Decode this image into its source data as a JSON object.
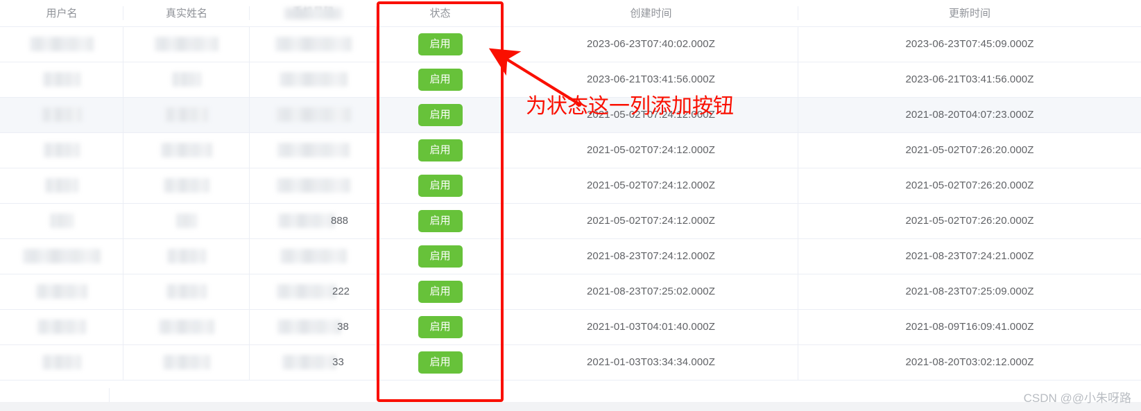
{
  "table": {
    "columns": [
      {
        "key": "username",
        "label": "用户名"
      },
      {
        "key": "realname",
        "label": "真实姓名"
      },
      {
        "key": "phone",
        "label": "手机号码",
        "redacted": true
      },
      {
        "key": "status",
        "label": "状态"
      },
      {
        "key": "create_time",
        "label": "创建时间"
      },
      {
        "key": "update_time",
        "label": "更新时间"
      }
    ],
    "status_button_label": "启用",
    "rows": [
      {
        "username": "",
        "realname": "",
        "phone_tail": "",
        "status": "启用",
        "create_time": "2023-06-23T07:40:02.000Z",
        "update_time": "2023-06-23T07:45:09.000Z",
        "striped": false
      },
      {
        "username": "",
        "realname": "",
        "phone_tail": "",
        "status": "启用",
        "create_time": "2023-06-21T03:41:56.000Z",
        "update_time": "2023-06-21T03:41:56.000Z",
        "striped": false
      },
      {
        "username": "",
        "realname": "",
        "phone_tail": "",
        "status": "启用",
        "create_time": "2021-05-02T07:24:12.000Z",
        "update_time": "2021-08-20T04:07:23.000Z",
        "striped": true
      },
      {
        "username": "",
        "realname": "",
        "phone_tail": "",
        "status": "启用",
        "create_time": "2021-05-02T07:24:12.000Z",
        "update_time": "2021-05-02T07:26:20.000Z",
        "striped": false
      },
      {
        "username": "",
        "realname": "",
        "phone_tail": "",
        "status": "启用",
        "create_time": "2021-05-02T07:24:12.000Z",
        "update_time": "2021-05-02T07:26:20.000Z",
        "striped": false
      },
      {
        "username": "",
        "realname": "",
        "phone_tail": "888",
        "status": "启用",
        "create_time": "2021-05-02T07:24:12.000Z",
        "update_time": "2021-05-02T07:26:20.000Z",
        "striped": false
      },
      {
        "username": "",
        "realname": "",
        "phone_tail": "",
        "status": "启用",
        "create_time": "2021-08-23T07:24:12.000Z",
        "update_time": "2021-08-23T07:24:21.000Z",
        "striped": false
      },
      {
        "username": "",
        "realname": "",
        "phone_tail": "222",
        "status": "启用",
        "create_time": "2021-08-23T07:25:02.000Z",
        "update_time": "2021-08-23T07:25:09.000Z",
        "striped": false
      },
      {
        "username": "",
        "realname": "",
        "phone_tail": "38",
        "status": "启用",
        "create_time": "2021-01-03T04:01:40.000Z",
        "update_time": "2021-08-09T16:09:41.000Z",
        "striped": false
      },
      {
        "username": "",
        "realname": "",
        "phone_tail": "33",
        "status": "启用",
        "create_time": "2021-01-03T03:34:34.000Z",
        "update_time": "2021-08-20T03:02:12.000Z",
        "striped": false
      }
    ]
  },
  "annotation": {
    "text": "为状态这一列添加按钮",
    "color": "#fa0f00",
    "highlight_column": "状态"
  },
  "watermark": {
    "text": "CSDN @@小朱呀路"
  },
  "colors": {
    "accent_green": "#67c23a",
    "annotation_red": "#fa0f00",
    "header_text": "#909399",
    "body_text": "#606266",
    "row_border": "#ebeef5",
    "striped_row": "#f5f7fa"
  }
}
